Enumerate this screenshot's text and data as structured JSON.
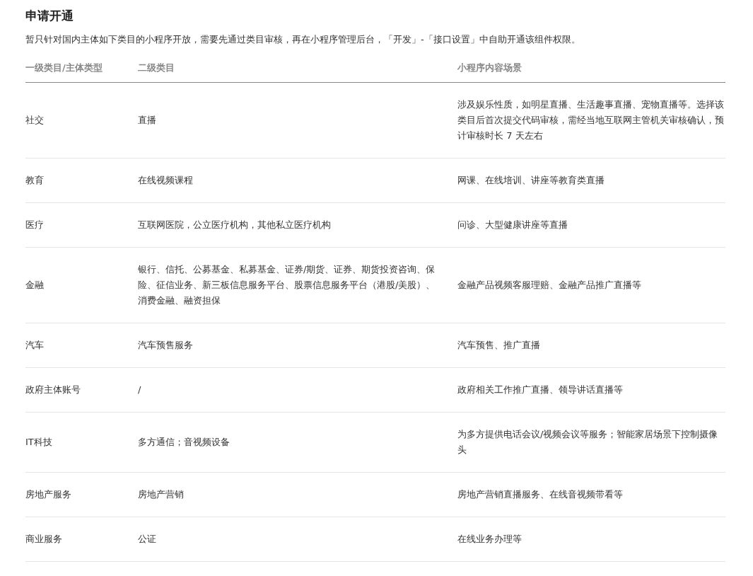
{
  "title": "申请开通",
  "intro": "暂只针对国内主体如下类目的小程序开放，需要先通过类目审核，再在小程序管理后台，「开发」-「接口设置」中自助开通该组件权限。",
  "table": {
    "columns": [
      "一级类目/主体类型",
      "二级类目",
      "小程序内容场景"
    ],
    "rows": [
      [
        "社交",
        "直播",
        "涉及娱乐性质，如明星直播、生活趣事直播、宠物直播等。选择该类目后首次提交代码审核，需经当地互联网主管机关审核确认，预计审核时长 7 天左右"
      ],
      [
        "教育",
        "在线视频课程",
        "网课、在线培训、讲座等教育类直播"
      ],
      [
        "医疗",
        "互联网医院，公立医疗机构，其他私立医疗机构",
        "问诊、大型健康讲座等直播"
      ],
      [
        "金融",
        "银行、信托、公募基金、私募基金、证券/期货、证券、期货投资咨询、保险、征信业务、新三板信息服务平台、股票信息服务平台（港股/美股）、消费金融、融资担保",
        "金融产品视频客服理赔、金融产品推广直播等"
      ],
      [
        "汽车",
        "汽车预售服务",
        "汽车预售、推广直播"
      ],
      [
        "政府主体账号",
        "/",
        "政府相关工作推广直播、领导讲话直播等"
      ],
      [
        "IT科技",
        "多方通信；音视频设备",
        "为多方提供电话会议/视频会议等服务；智能家居场景下控制摄像头"
      ],
      [
        "房地产服务",
        "房地产营销",
        "房地产营销直播服务、在线音视频带看等"
      ],
      [
        "商业服务",
        "公证",
        "在线业务办理等"
      ]
    ]
  }
}
